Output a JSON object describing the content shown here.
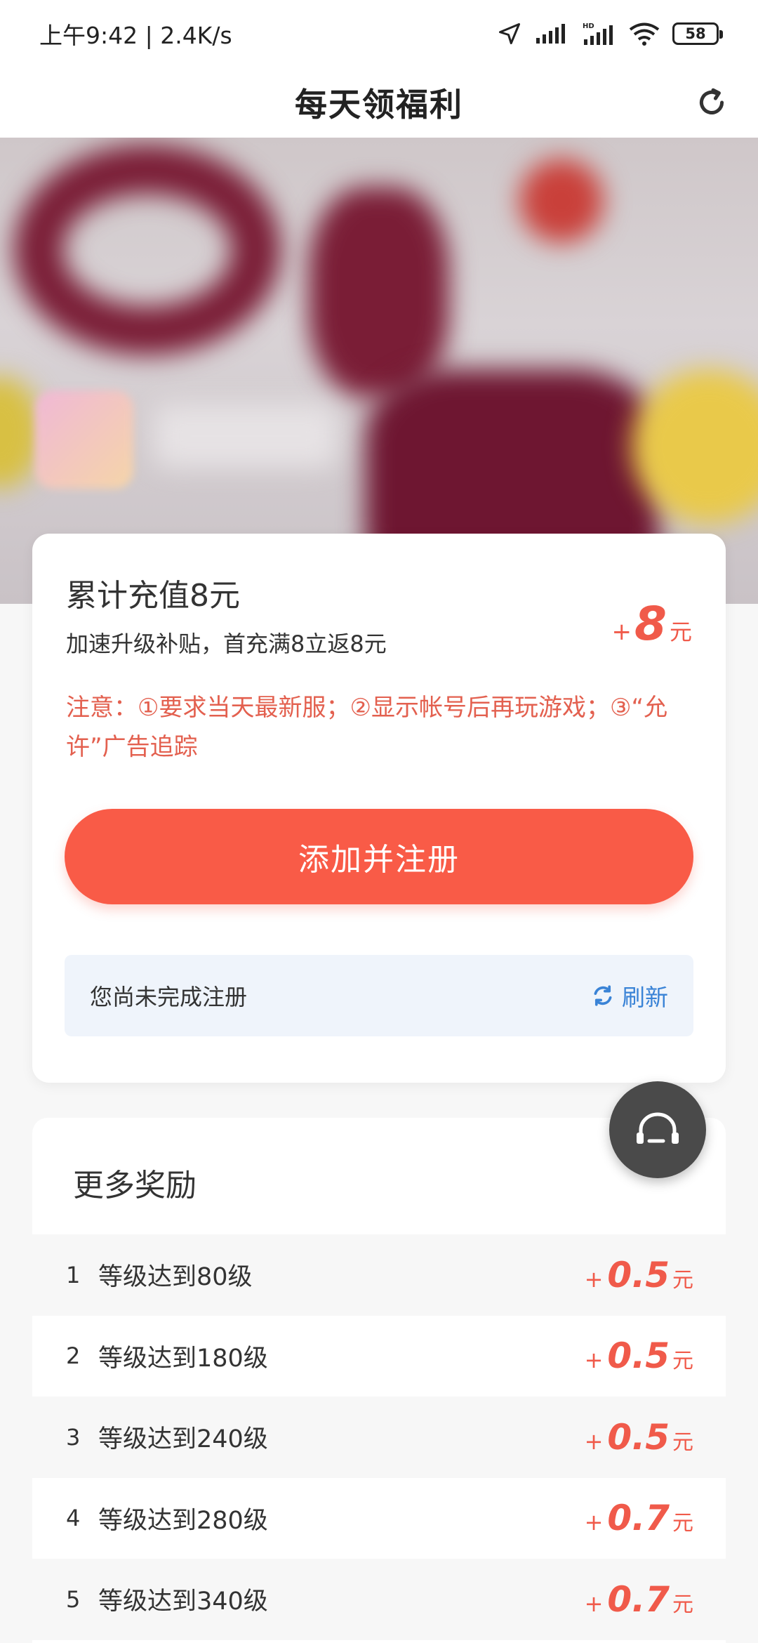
{
  "status_bar": {
    "time": "上午9:42 | 2.4K/s",
    "battery": "58"
  },
  "header": {
    "title": "每天领福利"
  },
  "main_task": {
    "title": "累计充值8元",
    "subtitle": "加速升级补贴，首充满8立返8元",
    "reward_plus": "+",
    "reward_amount": "8",
    "reward_unit": "元",
    "notice": "注意：①要求当天最新服；②显示帐号后再玩游戏；③“允许”广告追踪",
    "register_button": "添加并注册",
    "status_message": "您尚未完成注册",
    "refresh_label": "刷新"
  },
  "more_rewards": {
    "title": "更多奖励",
    "items": [
      {
        "index": "1",
        "desc": "等级达到80级",
        "plus": "+",
        "amount": "0.5",
        "unit": "元"
      },
      {
        "index": "2",
        "desc": "等级达到180级",
        "plus": "+",
        "amount": "0.5",
        "unit": "元"
      },
      {
        "index": "3",
        "desc": "等级达到240级",
        "plus": "+",
        "amount": "0.5",
        "unit": "元"
      },
      {
        "index": "4",
        "desc": "等级达到280级",
        "plus": "+",
        "amount": "0.7",
        "unit": "元"
      },
      {
        "index": "5",
        "desc": "等级达到340级",
        "plus": "+",
        "amount": "0.7",
        "unit": "元"
      }
    ]
  },
  "colors": {
    "accent_red": "#f95b47",
    "reward_red": "#f05a4a",
    "link_blue": "#3a83d6",
    "status_bg": "#eff4fb"
  },
  "icons": {
    "header_refresh": "refresh-icon",
    "status_refresh": "refresh-small-icon",
    "service": "headset-icon"
  }
}
